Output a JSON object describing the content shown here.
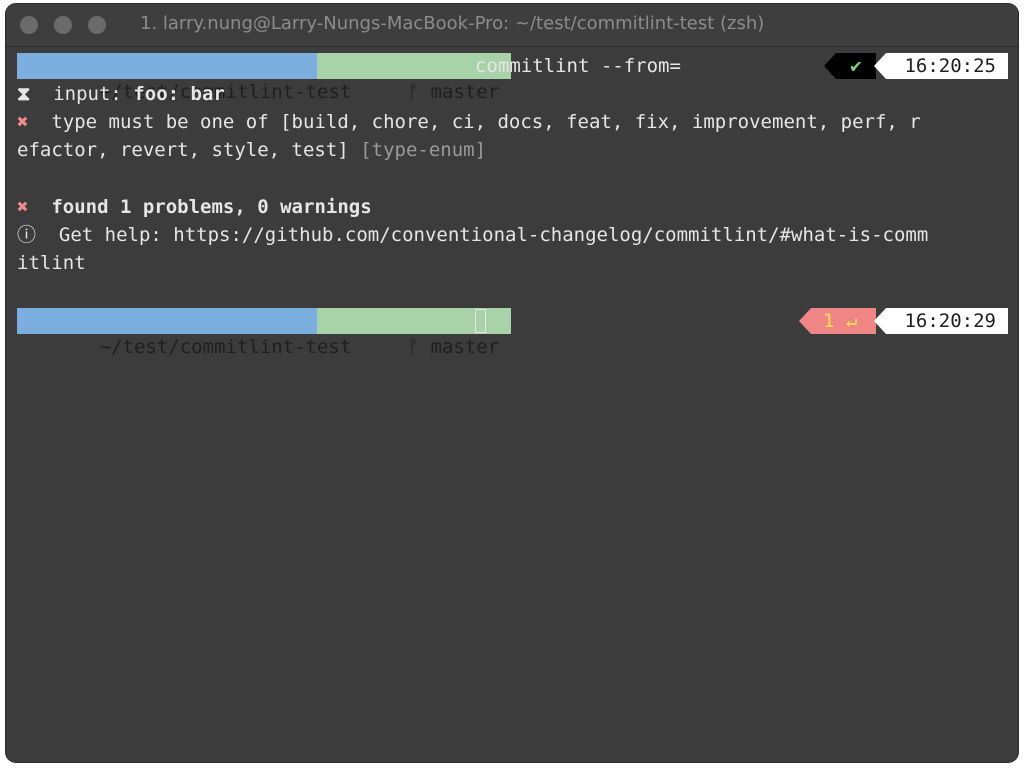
{
  "window": {
    "title": "1. larry.nung@Larry-Nungs-MacBook-Pro: ~/test/commitlint-test (zsh)"
  },
  "prompt1": {
    "dir": "~/test/commitlint-test",
    "branch_icon": "git-branch-icon",
    "branch_glyph": "ᚠ",
    "branch": "master",
    "command": "commitlint --from=",
    "status_icon": "check-icon",
    "status_glyph": "✔",
    "time": "16:20:25"
  },
  "output": {
    "input_icon": "hourglass-icon",
    "input_glyph": "⧗",
    "input_label": "input:",
    "input_value": "foo: bar",
    "error_glyph": "✖",
    "error_line1": "type must be one of [build, chore, ci, docs, feat, fix, improvement, perf, r",
    "error_line2": "efactor, revert, style, test]",
    "error_rule": "[type-enum]",
    "summary_glyph": "✖",
    "summary": "found 1 problems, 0 warnings",
    "info_glyph": "ⓘ",
    "help_line1": "Get help: https://github.com/conventional-changelog/commitlint/#what-is-comm",
    "help_line2": "itlint"
  },
  "prompt2": {
    "dir": "~/test/commitlint-test",
    "branch_glyph": "ᚠ",
    "branch": "master",
    "exit_code": "1",
    "exit_glyph": "↵",
    "time": "16:20:29"
  },
  "colors": {
    "background": "#3c3c3c",
    "dir_segment": "#7aaede",
    "git_segment": "#a8d3a8",
    "error": "#f38b8b",
    "exit_segment": "#f08585",
    "exit_text": "#ffe14d",
    "check": "#7bd37b"
  }
}
